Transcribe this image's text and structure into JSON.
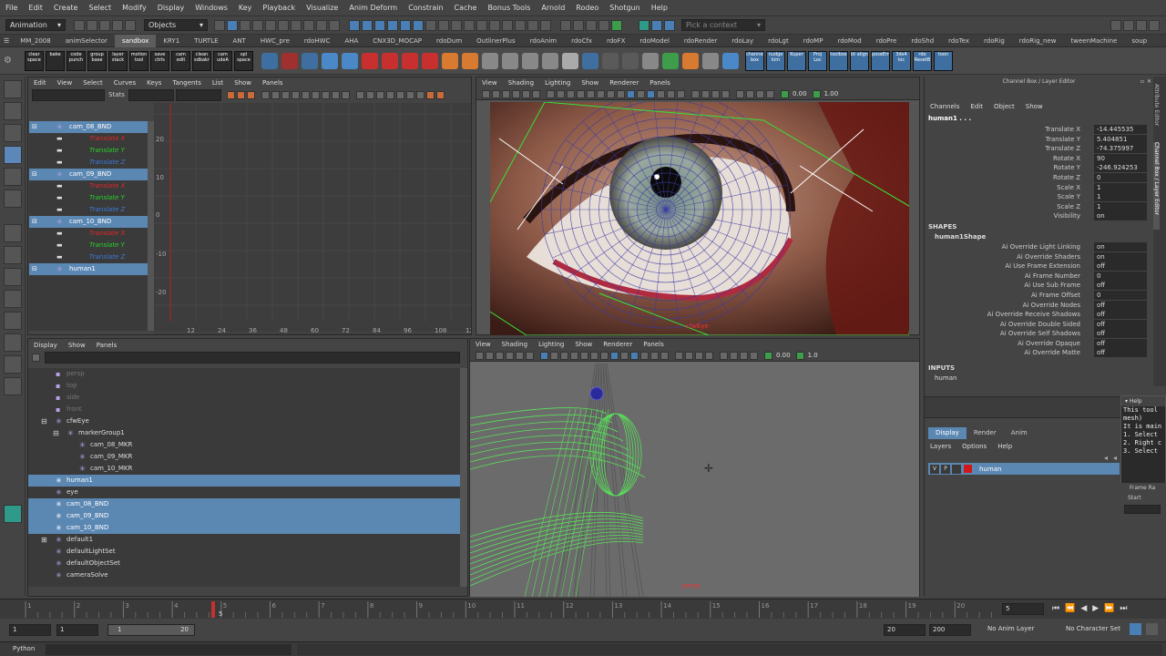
{
  "menubar": [
    "File",
    "Edit",
    "Create",
    "Select",
    "Modify",
    "Display",
    "Windows",
    "Key",
    "Playback",
    "Visualize",
    "Anim Deform",
    "Constrain",
    "Cache",
    "Bonus Tools",
    "Arnold",
    "Rodeo",
    "Shotgun",
    "Help"
  ],
  "status": {
    "mode": "Animation",
    "objects": "Objects",
    "context_placeholder": "Pick a context"
  },
  "shelf_tabs": [
    "MM_2008",
    "animSelector",
    "sandbox",
    "KRY1",
    "TURTLE",
    "ANT",
    "HWC_pre",
    "rdoHWC",
    "AHA",
    "CNX3D_MOCAP",
    "rdoDum",
    "OutlinerPlus",
    "rdoAnim",
    "rdoCfx",
    "rdoFX",
    "rdoModel",
    "rdoRender",
    "rdoLay",
    "rdoLgt",
    "rdoMP",
    "rdoMod",
    "rdoPre",
    "rdoShd",
    "rdoTex",
    "rdoRig",
    "rdoRig_new",
    "tweenMachine",
    "soup"
  ],
  "shelf_active": "sandbox",
  "shelf_icons": [
    "clear space",
    "bake",
    "code punch",
    "group base",
    "layer stack",
    "motion tool",
    "save ctrls",
    "cam edit",
    "clean sdbakr",
    "cam udeA",
    "spl space"
  ],
  "shelf_icons_right": [
    "channel box",
    "nudge kim",
    "Kuper",
    "Proj Loc",
    "toolbox",
    "bt align",
    "poseEm",
    "3de4 loc",
    "rdo ResetB",
    "toon"
  ],
  "graph_editor": {
    "menu": [
      "Edit",
      "View",
      "Select",
      "Curves",
      "Keys",
      "Tangents",
      "List",
      "Show",
      "Panels"
    ],
    "stats_label": "Stats",
    "outliner_items": [
      {
        "label": "cam_08_BND",
        "type": "header"
      },
      {
        "label": "Translate X",
        "type": "tx"
      },
      {
        "label": "Translate Y",
        "type": "ty"
      },
      {
        "label": "Translate Z",
        "type": "tz"
      },
      {
        "label": "cam_09_BND",
        "type": "header"
      },
      {
        "label": "Translate X",
        "type": "tx"
      },
      {
        "label": "Translate Y",
        "type": "ty"
      },
      {
        "label": "Translate Z",
        "type": "tz"
      },
      {
        "label": "cam_10_BND",
        "type": "header"
      },
      {
        "label": "Translate X",
        "type": "tx"
      },
      {
        "label": "Translate Y",
        "type": "ty"
      },
      {
        "label": "Translate Z",
        "type": "tz"
      },
      {
        "label": "human1",
        "type": "header"
      }
    ],
    "y_ticks": [
      "20",
      "10",
      "0",
      "-10",
      "-20"
    ],
    "x_ticks": [
      "12",
      "24",
      "36",
      "48",
      "60",
      "72",
      "84",
      "96",
      "108",
      "12"
    ]
  },
  "viewport_top": {
    "menu": [
      "View",
      "Shading",
      "Lighting",
      "Show",
      "Renderer",
      "Panels"
    ],
    "field1": "0.00",
    "field2": "1.00",
    "camera_label": "cfwEye"
  },
  "outliner": {
    "menu": [
      "Display",
      "Show",
      "Panels"
    ],
    "items": [
      {
        "label": "persp",
        "indent": 0,
        "dim": true,
        "sel": false
      },
      {
        "label": "top",
        "indent": 0,
        "dim": true,
        "sel": false
      },
      {
        "label": "side",
        "indent": 0,
        "dim": true,
        "sel": false
      },
      {
        "label": "front",
        "indent": 0,
        "dim": true,
        "sel": false
      },
      {
        "label": "cfwEye",
        "indent": 0,
        "dim": false,
        "sel": false,
        "expand": "-"
      },
      {
        "label": "markerGroup1",
        "indent": 1,
        "dim": false,
        "sel": false,
        "expand": "-"
      },
      {
        "label": "cam_08_MKR",
        "indent": 2,
        "dim": false,
        "sel": false
      },
      {
        "label": "cam_09_MKR",
        "indent": 2,
        "dim": false,
        "sel": false
      },
      {
        "label": "cam_10_MKR",
        "indent": 2,
        "dim": false,
        "sel": false
      },
      {
        "label": "human1",
        "indent": 0,
        "dim": false,
        "sel": true
      },
      {
        "label": "eye",
        "indent": 0,
        "dim": false,
        "sel": false
      },
      {
        "label": "cam_08_BND",
        "indent": 0,
        "dim": false,
        "sel": true
      },
      {
        "label": "cam_09_BND",
        "indent": 0,
        "dim": false,
        "sel": true
      },
      {
        "label": "cam_10_BND",
        "indent": 0,
        "dim": false,
        "sel": true
      },
      {
        "label": "default1",
        "indent": 0,
        "dim": false,
        "sel": false,
        "expand": "+"
      },
      {
        "label": "defaultLightSet",
        "indent": 0,
        "dim": false,
        "sel": false
      },
      {
        "label": "defaultObjectSet",
        "indent": 0,
        "dim": false,
        "sel": false
      },
      {
        "label": "cameraSolve",
        "indent": 0,
        "dim": false,
        "sel": false
      }
    ]
  },
  "viewport_bottom": {
    "menu": [
      "View",
      "Shading",
      "Lighting",
      "Show",
      "Renderer",
      "Panels"
    ],
    "field1": "0.00",
    "field2": "1.0",
    "camera_label": "persp"
  },
  "channel_box": {
    "title": "Channel Box / Layer Editor",
    "menu": [
      "Channels",
      "Edit",
      "Object",
      "Show"
    ],
    "object": "human1 . . .",
    "channels": [
      {
        "k": "Translate X",
        "v": "-14.445535"
      },
      {
        "k": "Translate Y",
        "v": "5.404851"
      },
      {
        "k": "Translate Z",
        "v": "-74.375997"
      },
      {
        "k": "Rotate X",
        "v": "90"
      },
      {
        "k": "Rotate Y",
        "v": "-246.924253"
      },
      {
        "k": "Rotate Z",
        "v": "0"
      },
      {
        "k": "Scale X",
        "v": "1"
      },
      {
        "k": "Scale Y",
        "v": "1"
      },
      {
        "k": "Scale Z",
        "v": "1"
      },
      {
        "k": "Visibility",
        "v": "on"
      }
    ],
    "shapes_label": "SHAPES",
    "shape_name": "human1Shape",
    "shape_channels": [
      {
        "k": "Ai Override Light Linking",
        "v": "on"
      },
      {
        "k": "Ai Override Shaders",
        "v": "on"
      },
      {
        "k": "Ai Use Frame Extension",
        "v": "off"
      },
      {
        "k": "Ai Frame Number",
        "v": "0"
      },
      {
        "k": "Ai Use Sub Frame",
        "v": "off"
      },
      {
        "k": "Ai Frame Offset",
        "v": "0"
      },
      {
        "k": "Ai Override Nodes",
        "v": "off"
      },
      {
        "k": "Ai Override Receive Shadows",
        "v": "off"
      },
      {
        "k": "Ai Override Double Sided",
        "v": "off"
      },
      {
        "k": "Ai Override Self Shadows",
        "v": "off"
      },
      {
        "k": "Ai Override Opaque",
        "v": "off"
      },
      {
        "k": "Ai Override Matte",
        "v": "off"
      }
    ],
    "inputs_label": "INPUTS",
    "input_name": "human",
    "layer_tabs": [
      "Display",
      "Render",
      "Anim"
    ],
    "layer_menu": [
      "Layers",
      "Options",
      "Help"
    ],
    "layer": {
      "v": "V",
      "p": "P",
      "name": "human"
    },
    "side_tabs": [
      "Attribute Editor",
      "Channel Box / Layer Editor"
    ]
  },
  "help_panel": {
    "title": "Help",
    "lines": [
      "This tool",
      "mesh)",
      "It is main",
      "1. Select",
      "2. Right c",
      "3. Select"
    ],
    "frame_label": "Frame Ra",
    "start_label": "Start"
  },
  "timeline": {
    "ticks": [
      "1",
      "2",
      "3",
      "4",
      "5",
      "6",
      "7",
      "8",
      "9",
      "10",
      "11",
      "12",
      "13",
      "14",
      "15",
      "16",
      "17",
      "18",
      "19",
      "20"
    ],
    "current_frame": "5",
    "current_field": "5"
  },
  "range": {
    "start": "1",
    "inner_start": "1",
    "slider_start": "1",
    "slider_end": "20",
    "end": "20",
    "outer_end": "200",
    "anim_layer": "No Anim Layer",
    "character_set": "No Character Set"
  },
  "cmdline": {
    "label": "Python"
  }
}
